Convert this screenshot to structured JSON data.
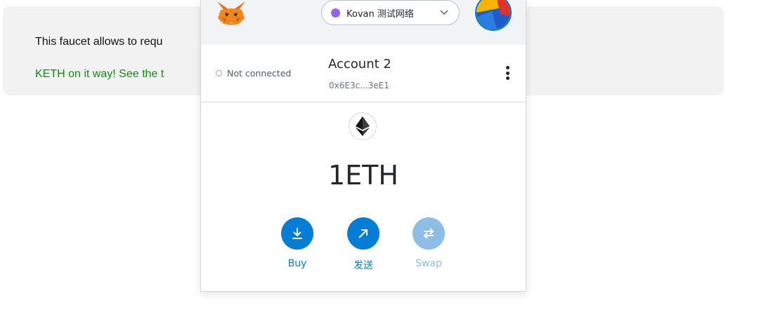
{
  "faucet": {
    "description": "This faucet allows to requ",
    "status": "KETH on it way! See the t"
  },
  "metamask": {
    "network": {
      "name": "Kovan 测试网络",
      "dot_color": "#9064ff"
    },
    "account": {
      "connection_status": "Not connected",
      "name": "Account 2",
      "address": "0x6E3c...3eE1"
    },
    "balance": "1ETH",
    "actions": [
      {
        "label": "Buy",
        "icon": "download-icon",
        "enabled": true
      },
      {
        "label": "发送",
        "icon": "arrow-up-right-icon",
        "enabled": true
      },
      {
        "label": "Swap",
        "icon": "swap-icon",
        "enabled": false
      }
    ],
    "colors": {
      "primary": "#037dd6",
      "primary_disabled": "#8ebde6",
      "header_bg": "#f2f3f4",
      "annotation_arrow": "#e0242b"
    }
  }
}
